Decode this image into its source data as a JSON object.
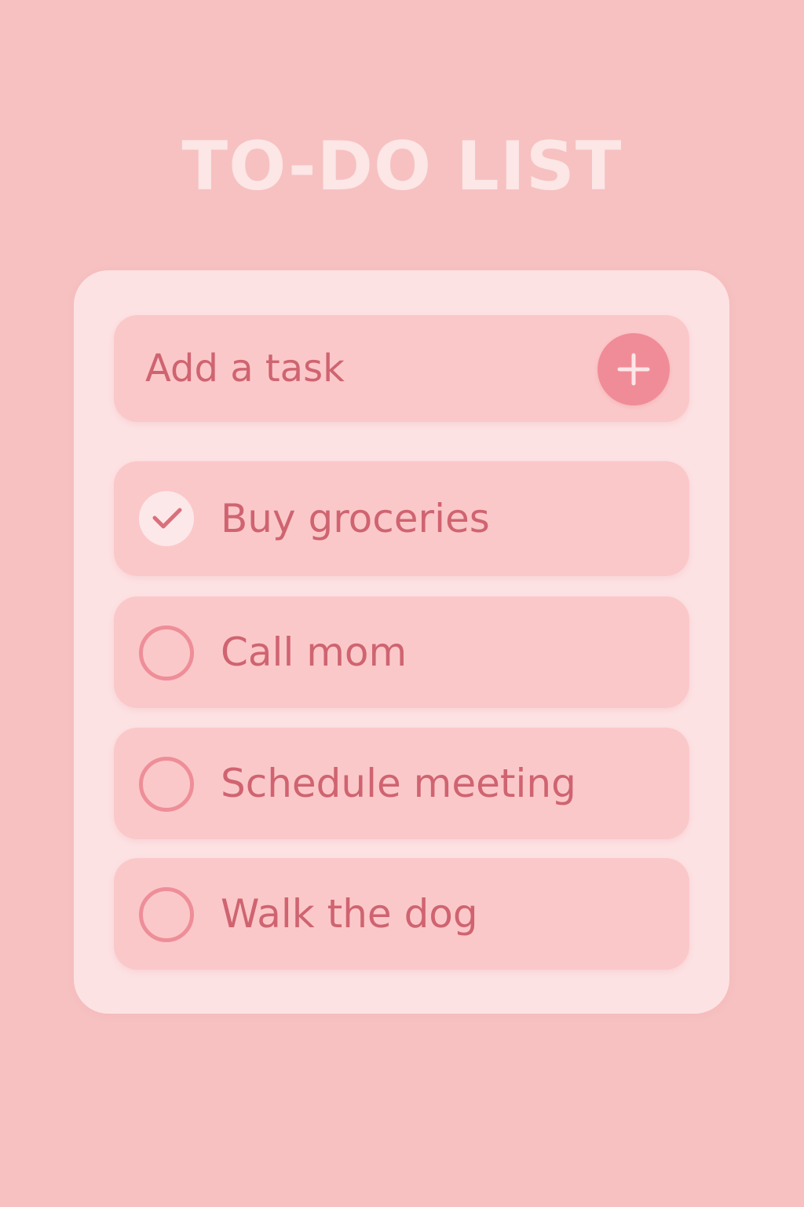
{
  "header": {
    "title": "TO-DO LIST"
  },
  "add_task": {
    "placeholder": "Add a task",
    "button_icon": "plus-icon"
  },
  "tasks": [
    {
      "label": "Buy groceries",
      "completed": true
    },
    {
      "label": "Call mom",
      "completed": false
    },
    {
      "label": "Schedule meeting",
      "completed": false
    },
    {
      "label": "Walk the dog",
      "completed": false
    }
  ],
  "colors": {
    "background": "#f7c1c1",
    "card": "#fde2e3",
    "row": "#fbc8ca",
    "accent": "#f08c97",
    "text": "#cf6470",
    "title": "#fce6e6"
  }
}
